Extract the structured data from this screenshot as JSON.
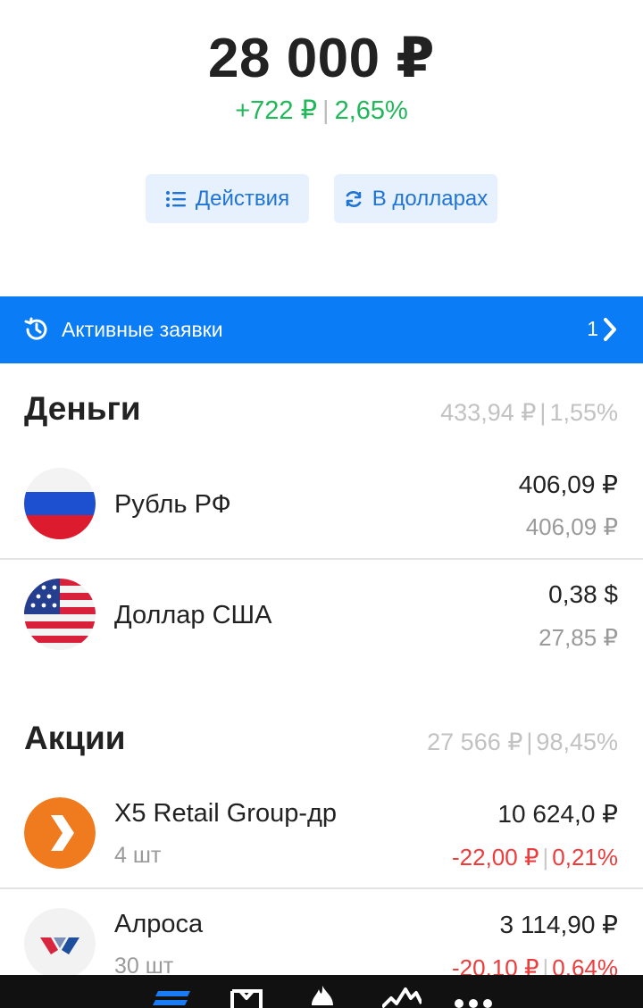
{
  "portfolio": {
    "total": "28 000 ₽",
    "change_abs": "+722 ₽",
    "separator": "|",
    "change_pct": "2,65%"
  },
  "buttons": {
    "actions_label": "Действия",
    "dollars_label": "В долларах"
  },
  "orders_bar": {
    "label": "Активные заявки",
    "count": "1"
  },
  "money": {
    "title": "Деньги",
    "sum_value": "433,94 ₽",
    "sum_pct": "1,55%",
    "items": [
      {
        "name": "Рубль РФ",
        "value": "406,09 ₽",
        "value_rub": "406,09 ₽",
        "logo": "russia-flag"
      },
      {
        "name": "Доллар США",
        "value": "0,38 $",
        "value_rub": "27,85 ₽",
        "logo": "usa-flag"
      }
    ]
  },
  "stocks": {
    "title": "Акции",
    "sum_value": "27 566 ₽",
    "sum_pct": "98,45%",
    "items": [
      {
        "name": "X5 Retail Group-др",
        "qty": "4 шт",
        "value": "10 624,0 ₽",
        "change_abs": "-22,00 ₽",
        "change_pct": "0,21%",
        "logo": "x5-logo"
      },
      {
        "name": "Алроса",
        "qty": "30 шт",
        "value": "3 114,90 ₽",
        "change_abs": "-20,10 ₽",
        "change_pct": "0,64%",
        "logo": "alrosa-logo"
      }
    ]
  },
  "colors": {
    "accent": "#0a7cf5",
    "positive": "#21b85a",
    "negative": "#ee3b3b",
    "button_bg": "#e6f1fd"
  },
  "tabbar": {
    "icons": [
      "portfolio-icon",
      "showcase-icon",
      "hot-icon",
      "market-icon",
      "more-icon"
    ]
  }
}
